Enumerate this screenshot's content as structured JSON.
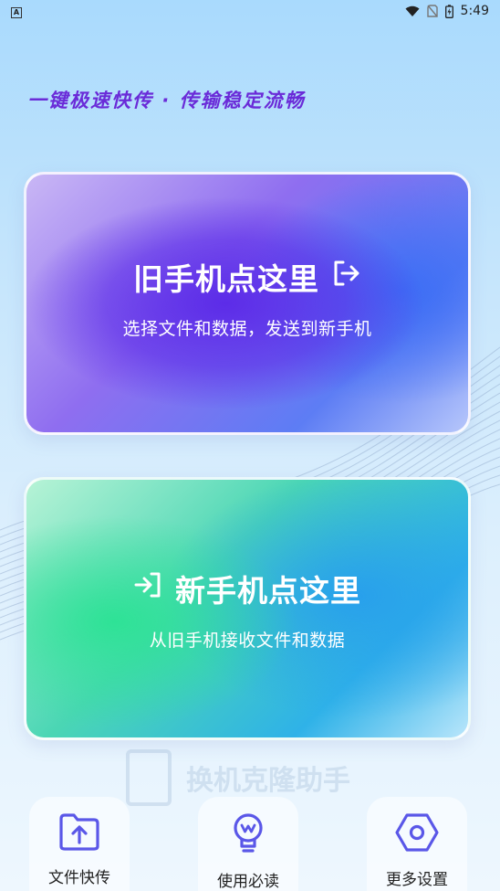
{
  "status_bar": {
    "left_badge": "A",
    "time": "5:49"
  },
  "header": {
    "slogan": "一键极速快传 · 传输稳定流畅"
  },
  "cards": {
    "old_phone": {
      "title": "旧手机点这里",
      "subtitle": "选择文件和数据，发送到新手机",
      "icon": "export-arrow-icon"
    },
    "new_phone": {
      "title": "新手机点这里",
      "subtitle": "从旧手机接收文件和数据",
      "icon": "import-arrow-icon"
    }
  },
  "watermark": {
    "text": "换机克隆助手"
  },
  "bottom_nav": {
    "items": [
      {
        "label": "文件快传",
        "icon": "folder-upload-icon"
      },
      {
        "label": "使用必读",
        "icon": "lightbulb-icon"
      },
      {
        "label": "更多设置",
        "icon": "hexagon-settings-icon"
      }
    ]
  },
  "colors": {
    "accent": "#5a57e8",
    "slogan": "#6a2bd8",
    "old_card": "#5c2ce8",
    "new_card": "#2ee296"
  }
}
